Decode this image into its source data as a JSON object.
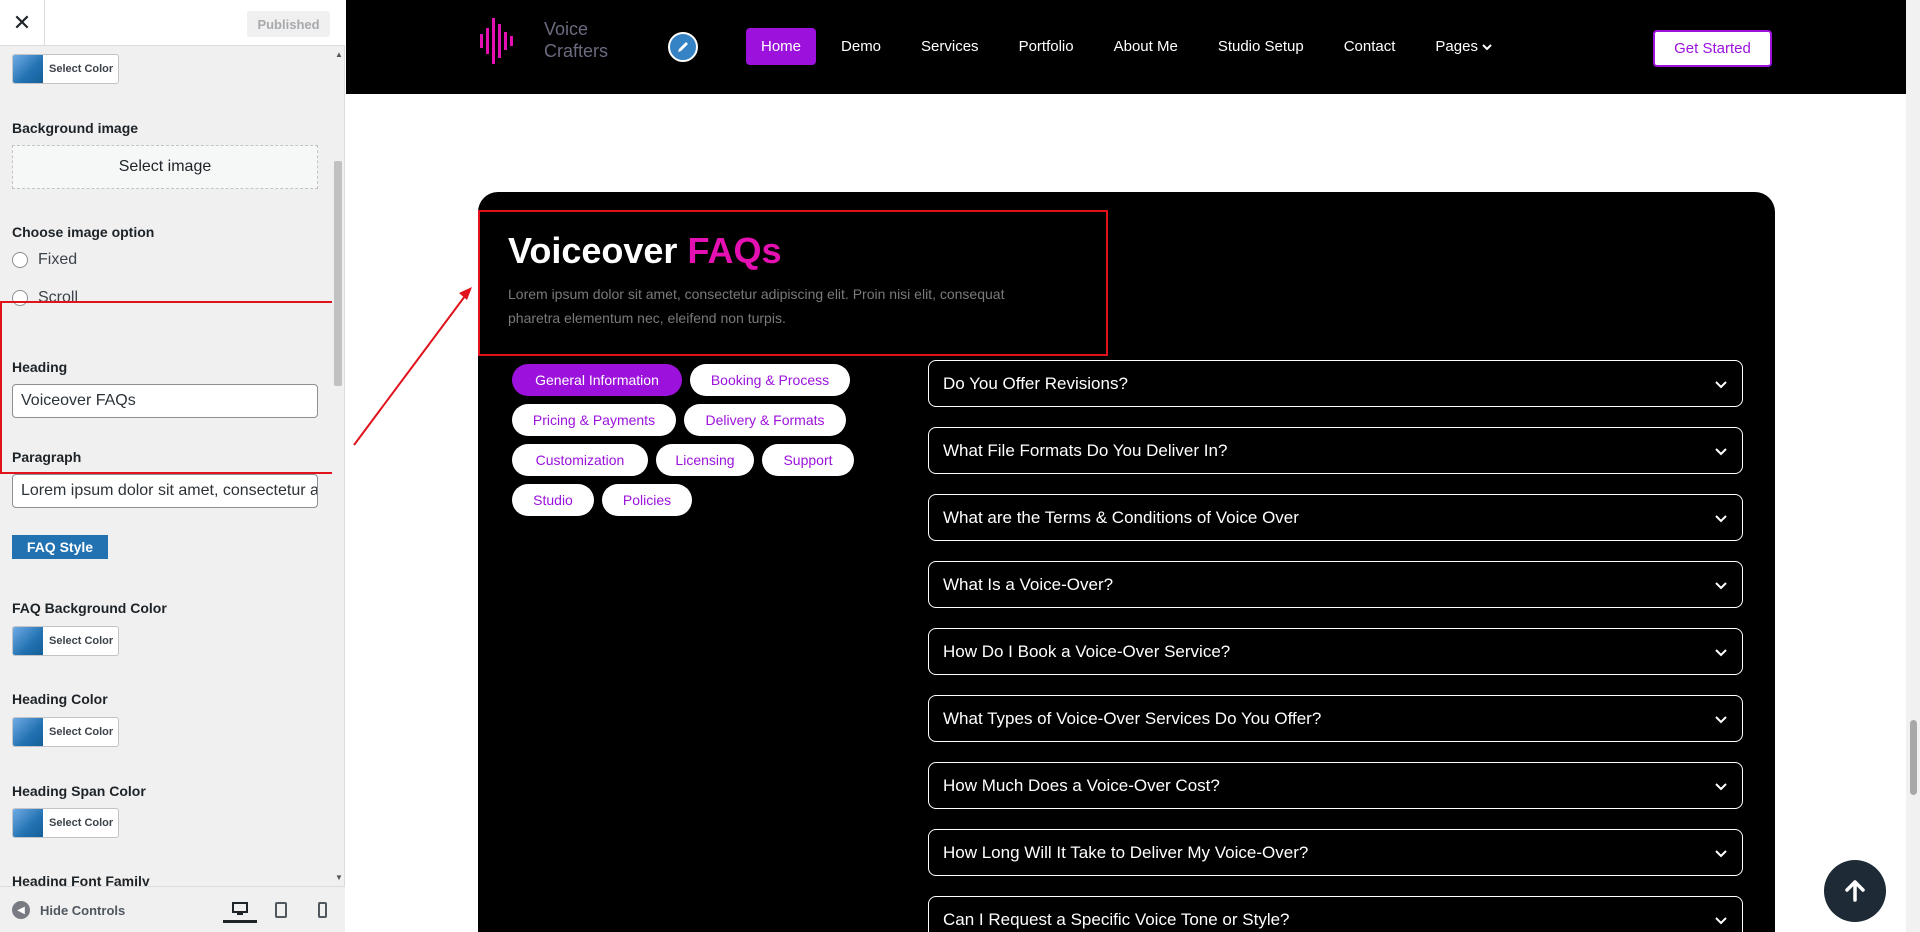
{
  "sidebar": {
    "close_icon": "close-icon",
    "status": "Published",
    "color_button_label": "Select Color",
    "background_image_label": "Background image",
    "select_image_label": "Select image",
    "image_option_label": "Choose image option",
    "radio_fixed": "Fixed",
    "radio_scroll": "Scroll",
    "heading_label": "Heading",
    "heading_value": "Voiceover FAQs",
    "paragraph_label": "Paragraph",
    "paragraph_value": "Lorem ipsum dolor sit amet, consectetur adipiscing elit. Proin nisi elit, consequat pharetra elementum nec, eleifend non turpis.",
    "faq_style_label": "FAQ Style",
    "faq_bg_color_label": "FAQ Background Color",
    "heading_color_label": "Heading Color",
    "heading_span_color_label": "Heading Span Color",
    "heading_font_family_label": "Heading Font Family",
    "hide_controls_label": "Hide Controls",
    "devices": [
      "desktop",
      "tablet",
      "mobile"
    ],
    "accent_color": "#2271b1"
  },
  "site": {
    "logo_line1": "Voice",
    "logo_line2": "Crafters",
    "nav": [
      "Home",
      "Demo",
      "Services",
      "Portfolio",
      "About Me",
      "Studio Setup",
      "Contact",
      "Pages"
    ],
    "active_nav": "Home",
    "cta": "Get Started",
    "brand_color": "#9c12dc",
    "span_color": "#e510b1"
  },
  "faq": {
    "heading_main": "Voiceover",
    "heading_span": "FAQs",
    "paragraph": "Lorem ipsum dolor sit amet, consectetur adipiscing elit. Proin nisi elit, consequat pharetra elementum nec, eleifend non turpis.",
    "tags": [
      "General Information",
      "Booking & Process",
      "Pricing & Payments",
      "Delivery & Formats",
      "Customization",
      "Licensing",
      "Support",
      "Studio",
      "Policies"
    ],
    "active_tag": "General Information",
    "questions": [
      "Do You Offer Revisions?",
      "What File Formats Do You Deliver In?",
      "What are the Terms & Conditions of Voice Over",
      "What Is a Voice-Over?",
      "How Do I Book a Voice-Over Service?",
      "What Types of Voice-Over Services Do You Offer?",
      "How Much Does a Voice-Over Cost?",
      "How Long Will It Take to Deliver My Voice-Over?",
      "Can I Request a Specific Voice Tone or Style?"
    ]
  }
}
